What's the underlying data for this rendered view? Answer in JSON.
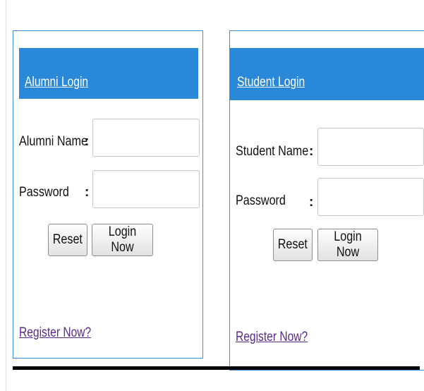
{
  "alumni": {
    "title": "Alumni Login",
    "name_label": "Alumni Name",
    "password_label": "Password",
    "colon": ":",
    "name_value": "",
    "password_value": "",
    "reset_label": "Reset",
    "login_label": "Login Now",
    "register_link": "Register Now?"
  },
  "student": {
    "title": "Student Login",
    "name_label": "Student Name",
    "password_label": "Password",
    "colon": ":",
    "name_value": "",
    "password_value": "",
    "reset_label": "Reset",
    "login_label": "Login Now",
    "register_link": "Register Now?"
  },
  "colors": {
    "header_blue": "#2a88d8",
    "panel_border": "#3b8fd6",
    "link_purple": "#5a2a8a"
  }
}
